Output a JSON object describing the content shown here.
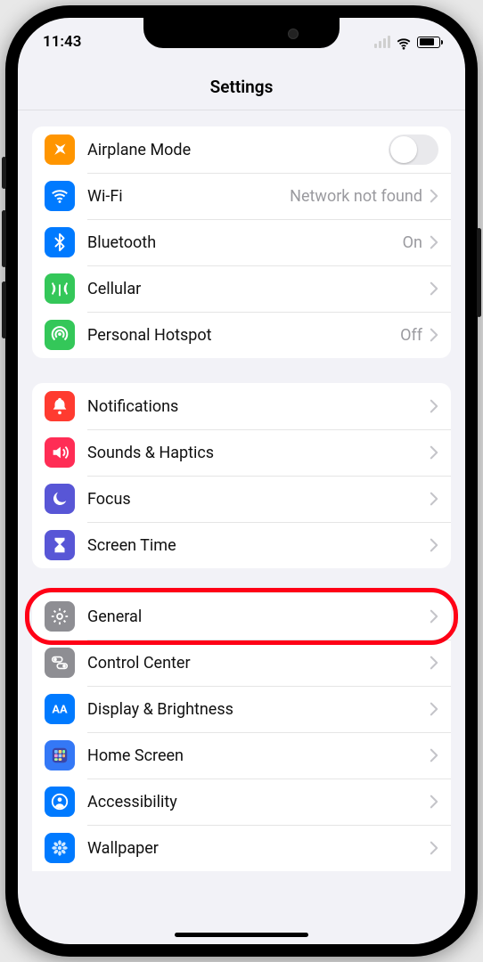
{
  "status": {
    "time": "11:43"
  },
  "title": "Settings",
  "group1": [
    {
      "id": "airplane",
      "icon": "airplane-icon",
      "color": "c-orange",
      "label": "Airplane Mode",
      "control": "toggle",
      "toggle_on": false
    },
    {
      "id": "wifi",
      "icon": "wifi-icon",
      "color": "c-blue",
      "label": "Wi-Fi",
      "value": "Network not found",
      "control": "chevron"
    },
    {
      "id": "bluetooth",
      "icon": "bluetooth-icon",
      "color": "c-blue",
      "label": "Bluetooth",
      "value": "On",
      "control": "chevron"
    },
    {
      "id": "cellular",
      "icon": "cellular-icon",
      "color": "c-green",
      "label": "Cellular",
      "control": "chevron"
    },
    {
      "id": "hotspot",
      "icon": "hotspot-icon",
      "color": "c-green",
      "label": "Personal Hotspot",
      "value": "Off",
      "control": "chevron"
    }
  ],
  "group2": [
    {
      "id": "notifications",
      "icon": "bell-icon",
      "color": "c-red",
      "label": "Notifications",
      "control": "chevron"
    },
    {
      "id": "sounds",
      "icon": "speaker-icon",
      "color": "c-pink",
      "label": "Sounds & Haptics",
      "control": "chevron"
    },
    {
      "id": "focus",
      "icon": "moon-icon",
      "color": "c-indigo",
      "label": "Focus",
      "control": "chevron"
    },
    {
      "id": "screentime",
      "icon": "hourglass-icon",
      "color": "c-indigo",
      "label": "Screen Time",
      "control": "chevron"
    }
  ],
  "group3": [
    {
      "id": "general",
      "icon": "gear-icon",
      "color": "c-grey",
      "label": "General",
      "control": "chevron",
      "highlight": true
    },
    {
      "id": "controlcenter",
      "icon": "switches-icon",
      "color": "c-grey",
      "label": "Control Center",
      "control": "chevron"
    },
    {
      "id": "display",
      "icon": "aa-icon",
      "color": "c-blue",
      "label": "Display & Brightness",
      "control": "chevron"
    },
    {
      "id": "homescreen",
      "icon": "grid-icon",
      "color": "c-purpleblue",
      "label": "Home Screen",
      "control": "chevron"
    },
    {
      "id": "accessibility",
      "icon": "person-icon",
      "color": "c-blue",
      "label": "Accessibility",
      "control": "chevron"
    },
    {
      "id": "wallpaper",
      "icon": "flower-icon",
      "color": "c-blue",
      "label": "Wallpaper",
      "control": "chevron"
    }
  ]
}
